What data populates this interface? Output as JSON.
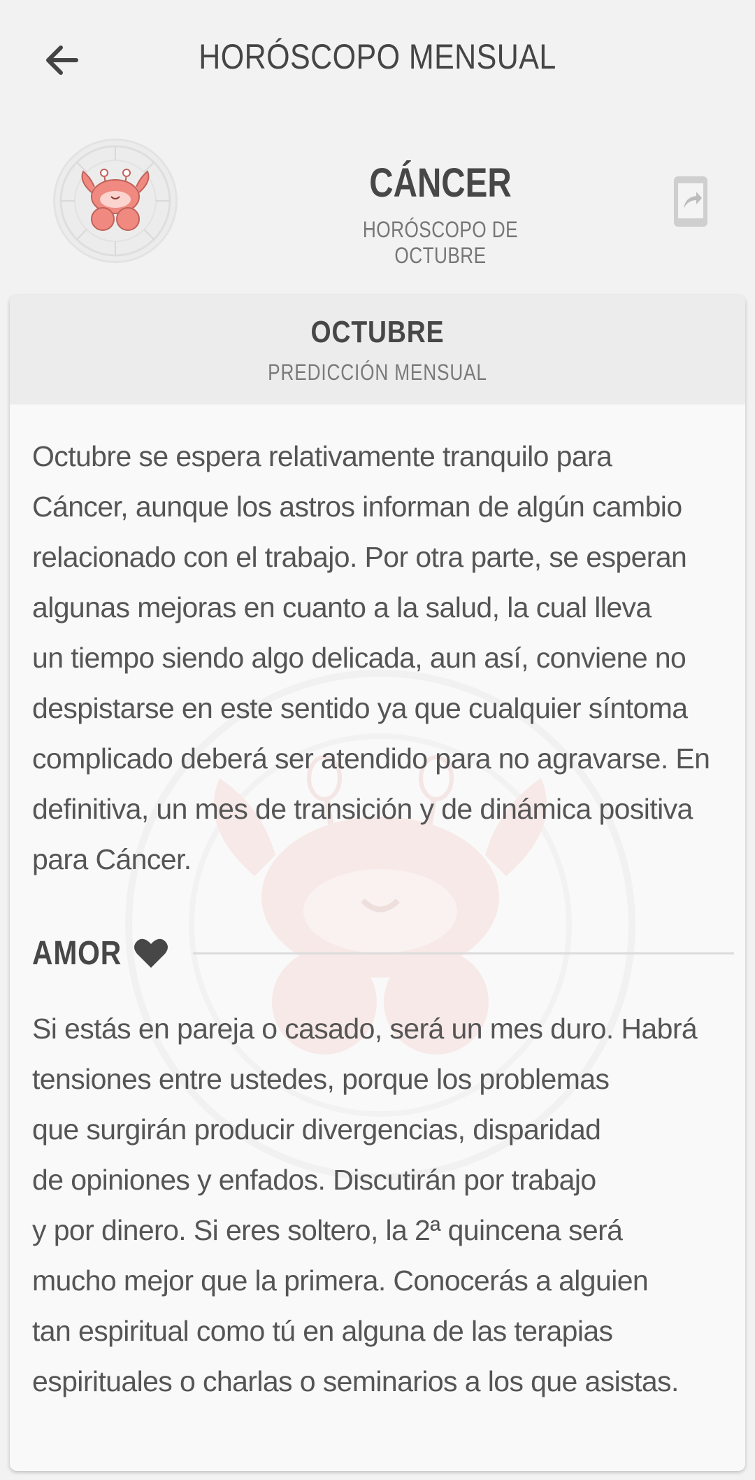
{
  "header": {
    "title": "HORÓSCOPO MENSUAL"
  },
  "sign": {
    "name": "CÁNCER",
    "subtitle": "HORÓSCOPO DE OCTUBRE"
  },
  "card": {
    "title": "OCTUBRE",
    "subtitle": "PREDICCIÓN MENSUAL",
    "general_lines": [
      "Octubre se espera relativamente tranquilo para",
      "Cáncer, aunque los astros informan de algún cambio",
      "relacionado con el trabajo. Por otra parte, se esperan",
      "algunas mejoras en cuanto a la salud, la cual lleva",
      "un tiempo siendo algo delicada, aun así, conviene no",
      "despistarse en este sentido ya que cualquier síntoma",
      "complicado deberá ser atendido para no agravarse. En",
      "definitiva, un mes de transición y de dinámica positiva",
      "para Cáncer."
    ],
    "love": {
      "title": "AMOR",
      "lines": [
        "Si estás en pareja o casado, será un mes duro. Habrá",
        "tensiones entre ustedes, porque los problemas",
        "que surgirán producir divergencias, disparidad",
        "de opiniones y enfados. Discutirán por trabajo",
        "y por dinero. Si eres soltero, la 2ª quincena será",
        "mucho mejor que la primera. Conocerás a alguien",
        "tan espiritual como tú en alguna de las terapias",
        "espirituales o charlas o seminarios a los que asistas."
      ]
    }
  },
  "icons": {
    "back": "arrow-left-icon",
    "share": "share-icon",
    "heart": "heart-icon",
    "avatar": "crab-icon"
  },
  "colors": {
    "background": "#f2f2f2",
    "card": "#f9f9f9",
    "card_header": "#ececec",
    "text": "#555555",
    "crab": "#f08a80"
  }
}
